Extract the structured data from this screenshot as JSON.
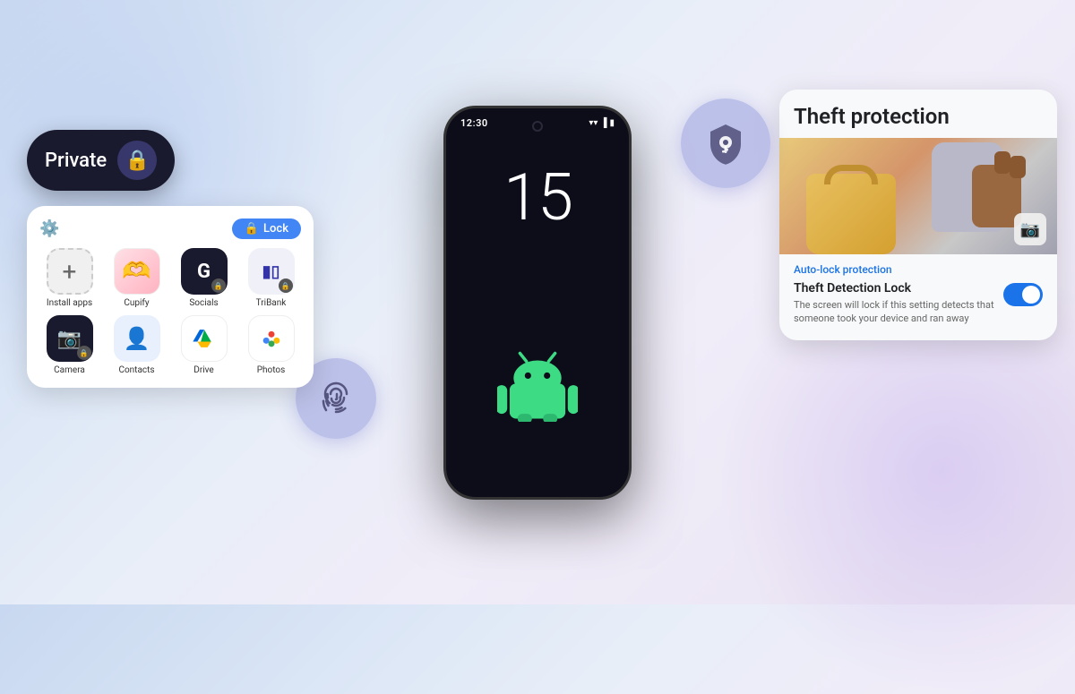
{
  "background": {
    "color_left": "#c8d8f0",
    "color_right": "#e8e0f0"
  },
  "private_pill": {
    "label": "Private",
    "icon": "🔒"
  },
  "app_grid": {
    "lock_button_label": "Lock",
    "apps": [
      {
        "name": "Install apps",
        "icon": "+",
        "type": "install"
      },
      {
        "name": "Cupify",
        "icon": "❤️",
        "type": "cupify"
      },
      {
        "name": "Socials",
        "icon": "G",
        "type": "socials"
      },
      {
        "name": "TriBank",
        "icon": "T",
        "type": "tribank"
      },
      {
        "name": "Camera",
        "icon": "📷",
        "type": "camera"
      },
      {
        "name": "Contacts",
        "icon": "👤",
        "type": "contacts"
      },
      {
        "name": "Drive",
        "icon": "▲",
        "type": "drive"
      },
      {
        "name": "Photos",
        "icon": "✿",
        "type": "photos"
      }
    ]
  },
  "phone": {
    "time": "12:30",
    "clock_number": "15"
  },
  "fingerprint": {
    "icon": "◉",
    "label": "fingerprint"
  },
  "shield": {
    "icon": "🔑",
    "label": "theft-shield"
  },
  "theft_protection": {
    "title": "Theft protection",
    "auto_lock_label": "Auto-lock protection",
    "detection_title": "Theft Detection Lock",
    "detection_desc": "The screen will lock if this setting detects that someone took your device and ran away",
    "toggle_enabled": true
  }
}
